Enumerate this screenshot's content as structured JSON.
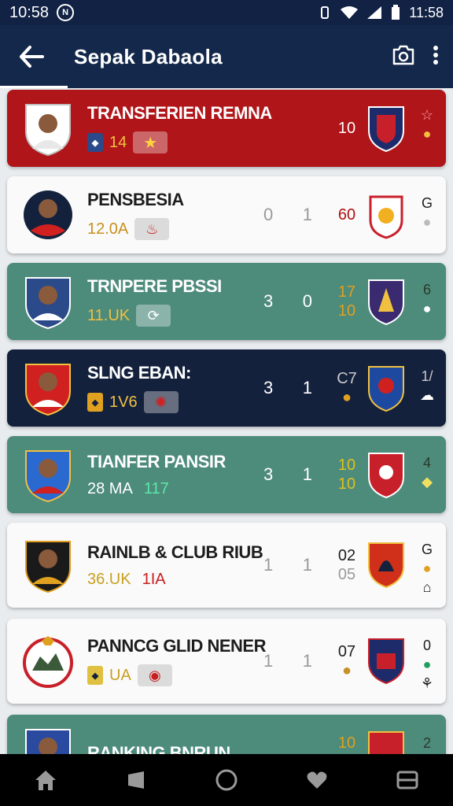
{
  "status": {
    "time": "10:58",
    "right_time": "11:58"
  },
  "header": {
    "title": "Sepak Dabaola"
  },
  "rows": [
    {
      "name": "TRANSFERIEN REMNA",
      "meta1": "14",
      "score": [
        "",
        ""
      ],
      "rank": [
        "10"
      ],
      "side": ""
    },
    {
      "name": "PENSBESIA",
      "meta1": "12.0A",
      "score": [
        "0",
        "1"
      ],
      "rank": [
        "60"
      ],
      "side": "G"
    },
    {
      "name": "TRNPERE PBSSI",
      "meta1": "11.UK",
      "score": [
        "3",
        "0"
      ],
      "rank": [
        "17",
        "10"
      ],
      "side": "6"
    },
    {
      "name": "SLNG EBAN:",
      "meta1": "1V6",
      "score": [
        "3",
        "1"
      ],
      "rank": [
        "C7"
      ],
      "side": "1/"
    },
    {
      "name": "TIANFER PANSIR",
      "meta1": "28 MA",
      "meta2": "117",
      "score": [
        "3",
        "1"
      ],
      "rank": [
        "10",
        "10"
      ],
      "side": "4"
    },
    {
      "name": "RAINLB & CLUB RIUB",
      "meta1": "36.UK",
      "meta2": "1IA",
      "score": [
        "1",
        "1"
      ],
      "rank": [
        "02",
        "05"
      ],
      "side": "G"
    },
    {
      "name": "PANNCG GLID NENER",
      "meta1": "UA",
      "score": [
        "1",
        "1"
      ],
      "rank": [
        "07"
      ],
      "side": "0"
    },
    {
      "name": "RANKING BNRUN",
      "meta1": "",
      "score": [
        "",
        ""
      ],
      "rank": [
        "10"
      ],
      "side": "2"
    }
  ],
  "colors": {
    "appbar": "#14284b",
    "red": "#b0151a",
    "teal": "#4d8b7b",
    "navy": "#14213d",
    "gold": "#e0a020",
    "green": "#28c878"
  },
  "icons": [
    "back-arrow-icon",
    "camera-icon",
    "more-vert-icon",
    "home-icon",
    "square-icon",
    "circle-icon",
    "heart-icon",
    "menu-icon"
  ]
}
